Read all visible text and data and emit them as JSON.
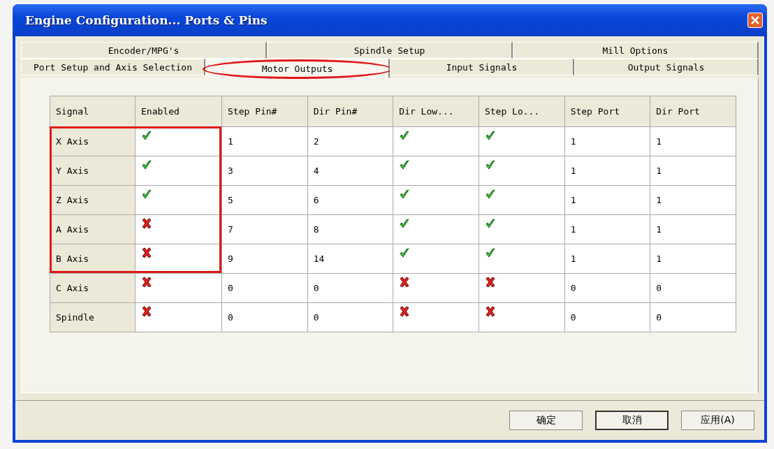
{
  "window": {
    "title": "Engine Configuration... Ports & Pins"
  },
  "tab_rows": [
    [
      {
        "label": "Encoder/MPG's",
        "selected": false,
        "circled": false
      },
      {
        "label": "Spindle Setup",
        "selected": false,
        "circled": false
      },
      {
        "label": "Mill Options",
        "selected": false,
        "circled": false
      }
    ],
    [
      {
        "label": "Port Setup and Axis Selection",
        "selected": false,
        "circled": false
      },
      {
        "label": "Motor Outputs",
        "selected": true,
        "circled": true
      },
      {
        "label": "Input Signals",
        "selected": false,
        "circled": false
      },
      {
        "label": "Output Signals",
        "selected": false,
        "circled": false
      }
    ]
  ],
  "table": {
    "columns": [
      {
        "label": "Signal",
        "kind": "text"
      },
      {
        "label": "Enabled",
        "kind": "flag"
      },
      {
        "label": "Step Pin#",
        "kind": "text"
      },
      {
        "label": "Dir Pin#",
        "kind": "text"
      },
      {
        "label": "Dir Low...",
        "kind": "flag"
      },
      {
        "label": "Step Lo...",
        "kind": "flag"
      },
      {
        "label": "Step Port",
        "kind": "text"
      },
      {
        "label": "Dir Port",
        "kind": "text"
      }
    ],
    "rows": [
      {
        "cells": [
          "X Axis",
          true,
          "1",
          "2",
          true,
          true,
          "1",
          "1"
        ],
        "boxed": true
      },
      {
        "cells": [
          "Y Axis",
          true,
          "3",
          "4",
          true,
          true,
          "1",
          "1"
        ],
        "boxed": true
      },
      {
        "cells": [
          "Z Axis",
          true,
          "5",
          "6",
          true,
          true,
          "1",
          "1"
        ],
        "boxed": true
      },
      {
        "cells": [
          "A Axis",
          false,
          "7",
          "8",
          true,
          true,
          "1",
          "1"
        ],
        "boxed": true
      },
      {
        "cells": [
          "B Axis",
          false,
          "9",
          "14",
          true,
          true,
          "1",
          "1"
        ],
        "boxed": true
      },
      {
        "cells": [
          "C Axis",
          false,
          "0",
          "0",
          false,
          false,
          "0",
          "0"
        ],
        "boxed": false
      },
      {
        "cells": [
          "Spindle",
          false,
          "0",
          "0",
          false,
          false,
          "0",
          "0"
        ],
        "boxed": false
      }
    ]
  },
  "buttons": [
    {
      "label": "确定",
      "default": false
    },
    {
      "label": "取消",
      "default": true
    },
    {
      "label": "应用(A)",
      "default": false
    }
  ]
}
